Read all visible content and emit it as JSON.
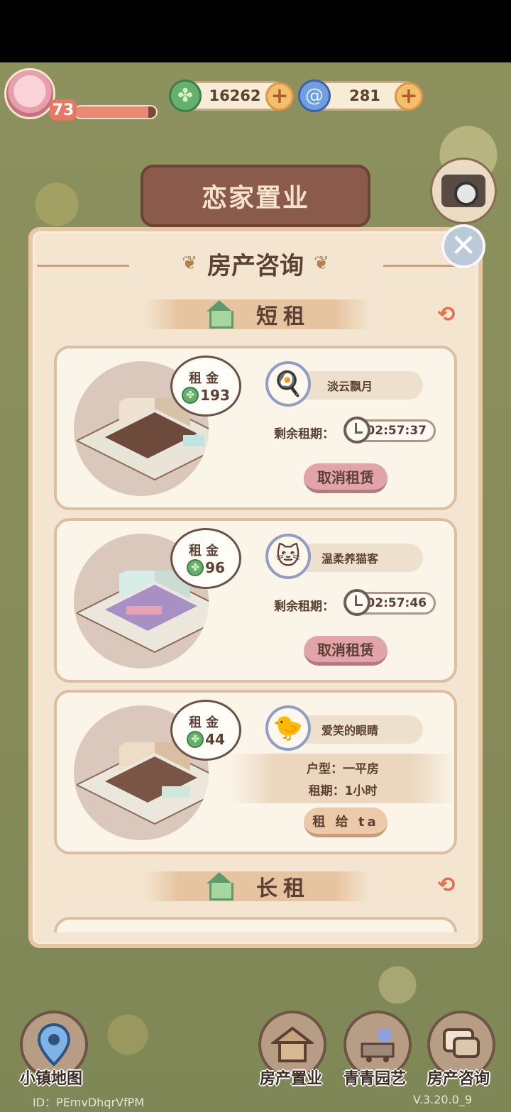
{
  "hud": {
    "level": "73",
    "xp_fraction": 0.9,
    "clover_currency": "16262",
    "spiral_currency": "281",
    "plus_label": "+"
  },
  "scene": {
    "sign_title": "恋家置业"
  },
  "panel": {
    "title": "房产咨询",
    "close_label": "✕",
    "short_rent_header": "短租",
    "long_rent_header": "长租",
    "refresh_icon": "⟲",
    "listings": [
      {
        "rent_label": "租金",
        "rent_value": "193",
        "tenant_name": "淡云飘月",
        "tenant_icon": "🍳",
        "remaining_label": "剩余租期：",
        "remaining_time": "02:57:37",
        "action_label": "取消租赁"
      },
      {
        "rent_label": "租金",
        "rent_value": "96",
        "tenant_name": "温柔养猫客",
        "tenant_icon": "🐱",
        "remaining_label": "剩余租期：",
        "remaining_time": "02:57:46",
        "action_label": "取消租赁"
      },
      {
        "rent_label": "租金",
        "rent_value": "44",
        "tenant_name": "爱笑的眼睛",
        "tenant_icon": "🐤",
        "layout_info": "户型：一平房",
        "term_info": "租期：1小时",
        "action_label": "租 给 ta"
      }
    ]
  },
  "bottom_nav": {
    "map": "小镇地图",
    "property": "房产置业",
    "garden": "青青园艺",
    "consult": "房产咨询"
  },
  "footer": {
    "id_text": "ID：PEmvDhqrVfPM",
    "version": "V.3.20.0_9"
  },
  "colors": {
    "panel_bg": "#f3e5cf",
    "cancel_button": "#e3a3aa",
    "rent_button": "#ecc9a8",
    "clover_green": "#66b06e"
  }
}
